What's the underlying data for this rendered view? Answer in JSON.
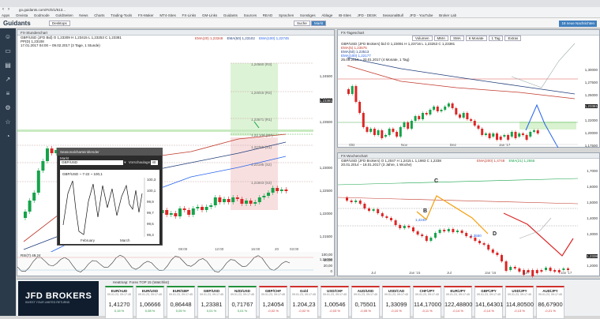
{
  "browser": {
    "url": "go.guidants.com/#c/5/1/613...",
    "bookmarks": [
      "Apps",
      "Onvista",
      "Godmode",
      "GoldSeiten",
      "News",
      "Charts",
      "Trading-Tools",
      "FX-Maker",
      "MT4-Sites",
      "FX-Links",
      "GM-Links",
      "Guidants",
      "Sources",
      "READ",
      "Sprachen",
      "Sonstiges",
      "Ablage",
      "IB-Sites",
      "JFD - DESK",
      "SeasonalBull",
      "JFD - YouTube",
      "Broker Lab"
    ]
  },
  "app": {
    "logo": "Guidants",
    "desktop_label": "Desktops",
    "search_label": "Suche",
    "market_label": "Markt",
    "notification": "18 neue Nachrichten"
  },
  "panel_hourly": {
    "title": "FX-Stundenchart",
    "legend1": "GBP/USD (JFD Bid)  O 1,23309  H 1,23415  L 1,23253  C 1,23381",
    "legend2": "PP(D)  1,23108",
    "legend3": "17.01.2017 04:00 – 09.02.2017  (3 Tage, 1 Stunde)",
    "ma_labels": [
      "EMA(20) 1,23348",
      "EMA(50) 1,23102",
      "EMA(100) 1,22745"
    ],
    "prices": [
      "1,24500",
      "1,24000",
      "1,23500",
      "1,23381",
      "1,23000",
      "1,22500",
      "1,22000",
      "1,21500",
      "1,21000",
      "1,20500"
    ],
    "levels": [
      "1,24560 (R3)",
      "1,24015 (R2)",
      "1,23571 (R1)",
      "1,23 108 (PP)",
      "1,22759 (S1)",
      "1,22195 (S2)",
      "1,21843 (S3)"
    ],
    "times": [
      "08:00",
      "12:00",
      "16:00",
      "20",
      "03:00"
    ],
    "rsi_label": "RSI(7)  49,24",
    "rsi_levels": [
      "100,00",
      "80,00",
      "20,00",
      "0"
    ]
  },
  "mini_window": {
    "title": "Seasonalcharteinblender",
    "field_label": "Markt",
    "symbol": "GBP/USD",
    "lookback_label": "Vorschaulage",
    "lookback_value": "40",
    "series_label": "GBP/USD ~ 7-22 ~ 100,1",
    "axis": [
      "100,3",
      "100,1",
      "99,9",
      "99,7",
      "99,5",
      "99,3"
    ],
    "months": [
      "February",
      "March"
    ]
  },
  "panel_daily": {
    "title": "FX-Tageschart",
    "legend1": "GBP/USD (JFD Brokers)  bid  O 1,23091  H 1,23716  L 1,23253  C 1,23381",
    "legend_mas": [
      "EMA(5)  1,23575",
      "EMA(50)  1,23513",
      "EMA(100) 1,22177"
    ],
    "legend3": "25.09.2016 – 20.01.2017  (4 Monate, 1 Tag)",
    "toolbar": [
      "Volumen",
      "MMA",
      "SMA",
      "6 Monate",
      "1 Tag",
      "Extras"
    ],
    "prices": [
      "1,30000",
      "1,27500",
      "1,25000",
      "1,23381",
      "1,22000",
      "1,20000",
      "1,17500"
    ],
    "times": [
      "Okt",
      "Nov",
      "Dez",
      "Jan '17"
    ]
  },
  "panel_weekly": {
    "title": "FX-Wochenchart",
    "legend1": "GBP/USD (JFD Brokers)  O 1,2047  H 1,2415  L 1,1983  C 1,2338",
    "legend_mas": [
      "EMA(200) 1,4748",
      "EMA(21) 1,2555"
    ],
    "legend3": "20.01.2014 – 18.01.2017  (3 Jahre, 1 Woche)",
    "labels": [
      "C",
      "B",
      "D"
    ],
    "level_labels": [
      "1,4240",
      "1,3550"
    ],
    "prices": [
      "1,7000",
      "1,6000",
      "1,5000",
      "1,4000",
      "1,3000",
      "1,2338",
      "1,2000"
    ],
    "times": [
      "Jul",
      "Jan '15",
      "Jul",
      "Jan '16",
      "Jul",
      "Jan '17"
    ]
  },
  "heatmap": {
    "title": "Heatmap: Forex TOP 15 (Watchlist)",
    "brand": "JFD BROKERS",
    "brand_sub": "INVEST YOUR LIMITED RETURNS",
    "tickers": [
      {
        "name": "EUR/AUD",
        "time": "09.01.23, 09:17:45",
        "value": "1,41270",
        "change": "0,15 %",
        "dir": "up"
      },
      {
        "name": "EUR/USD",
        "time": "09.01.23, 09:17:45",
        "value": "1,06666",
        "change": "0,08 %",
        "dir": "up"
      },
      {
        "name": "EUR/GBP",
        "time": "09.01.23, 09:17:45",
        "value": "0,86448",
        "change": "0,05 %",
        "dir": "up"
      },
      {
        "name": "GBP/USD",
        "time": "09.01.23, 09:17:45",
        "value": "1,23381",
        "change": "0,01 %",
        "dir": "up"
      },
      {
        "name": "NZD/USD",
        "time": "09.01.23, 09:17:45",
        "value": "0,71767",
        "change": "0,01 %",
        "dir": "up"
      },
      {
        "name": "GBP/CHF",
        "time": "09.01.23, 09:17:45",
        "value": "1,24054",
        "change": "-0,02 %",
        "dir": "dn"
      },
      {
        "name": "Gold",
        "time": "09.01.23, 09:17:45",
        "value": "1.204,23",
        "change": "-0,02 %",
        "dir": "dn"
      },
      {
        "name": "USD/CHF",
        "time": "09.01.23, 09:17:45",
        "value": "1,00546",
        "change": "-0,03 %",
        "dir": "dn"
      },
      {
        "name": "AUD/USD",
        "time": "09.01.23, 09:17:45",
        "value": "0,75501",
        "change": "-0,05 %",
        "dir": "dn"
      },
      {
        "name": "USD/CAD",
        "time": "09.01.23, 09:17:45",
        "value": "1,33099",
        "change": "-0,10 %",
        "dir": "dn"
      },
      {
        "name": "CHF/JPY",
        "time": "09.01.23, 09:17:45",
        "value": "114,17000",
        "change": "-0,11 %",
        "dir": "dn"
      },
      {
        "name": "EUR/JPY",
        "time": "09.01.23, 09:17:45",
        "value": "122,48800",
        "change": "-0,14 %",
        "dir": "dn"
      },
      {
        "name": "GBP/JPY",
        "time": "09.01.23, 09:17:45",
        "value": "141,64301",
        "change": "-0,14 %",
        "dir": "dn"
      },
      {
        "name": "USD/JPY",
        "time": "09.01.23, 09:17:45",
        "value": "114,80500",
        "change": "-0,13 %",
        "dir": "dn"
      },
      {
        "name": "AUD/JPY",
        "time": "09.01.23, 09:17:45",
        "value": "86,67900",
        "change": "-0,21 %",
        "dir": "dn"
      }
    ]
  }
}
